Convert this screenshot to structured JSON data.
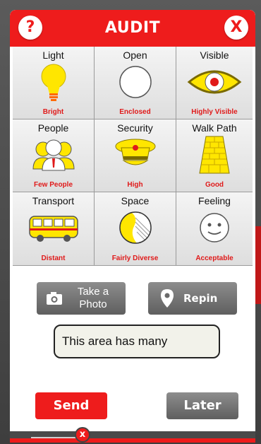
{
  "header": {
    "title": "AUDIT",
    "help_label": "?",
    "close_label": "X"
  },
  "colors": {
    "accent": "#ee1c1c",
    "button_gray": "#6f6f6f",
    "icon_yellow": "#ffe600"
  },
  "audit_grid": [
    {
      "title": "Light",
      "value": "Bright",
      "icon": "lightbulb-icon"
    },
    {
      "title": "Open",
      "value": "Enclosed",
      "icon": "circle-icon"
    },
    {
      "title": "Visible",
      "value": "Highly Visible",
      "icon": "eye-icon"
    },
    {
      "title": "People",
      "value": "Few People",
      "icon": "people-icon"
    },
    {
      "title": "Security",
      "value": "High",
      "icon": "security-cap-icon"
    },
    {
      "title": "Walk Path",
      "value": "Good",
      "icon": "brick-path-icon"
    },
    {
      "title": "Transport",
      "value": "Distant",
      "icon": "bus-icon"
    },
    {
      "title": "Space",
      "value": "Fairly Diverse",
      "icon": "space-icon"
    },
    {
      "title": "Feeling",
      "value": "Acceptable",
      "icon": "smiley-icon"
    }
  ],
  "actions": {
    "take_photo_line1": "Take a",
    "take_photo_line2": "Photo",
    "repin": "Repin"
  },
  "comment": {
    "value": "This area has many"
  },
  "footer": {
    "send": "Send",
    "later": "Later",
    "dismiss": "x"
  }
}
